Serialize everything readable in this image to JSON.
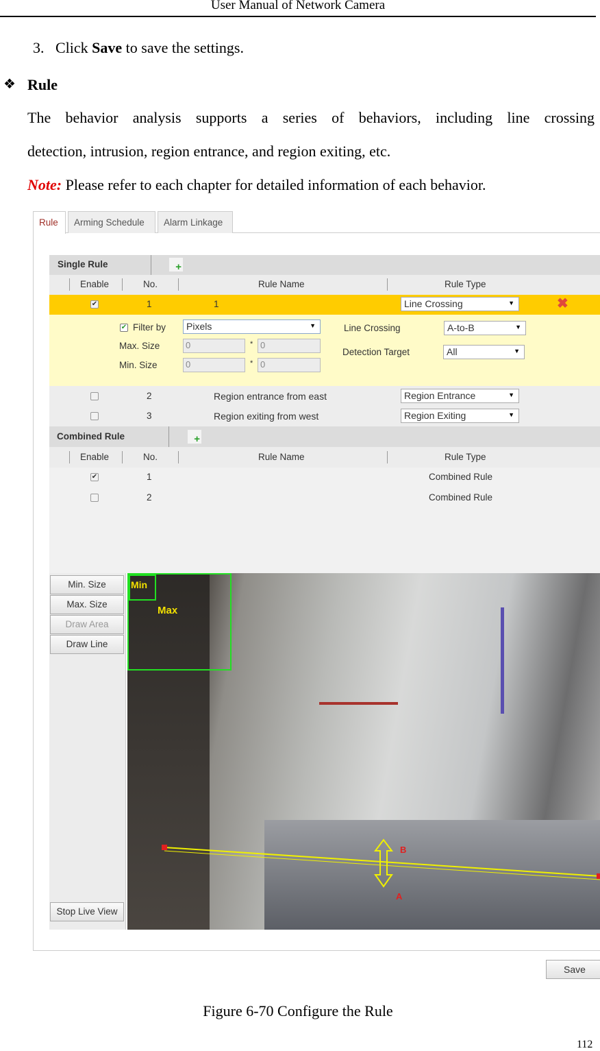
{
  "header": {
    "title": "User Manual of Network Camera"
  },
  "step": {
    "number": "3.",
    "prefix": "Click ",
    "bold": "Save",
    "suffix": " to save the settings."
  },
  "section": {
    "bullet_icon": "diamond-bullet-icon",
    "title": "Rule"
  },
  "paragraph": {
    "line1": "The behavior analysis supports a series of behaviors, including line crossing",
    "line2": "detection, intrusion, region entrance, and region exiting, etc."
  },
  "note": {
    "label": "Note:",
    "text": " Please refer to each chapter for detailed information of each behavior."
  },
  "ui": {
    "tabs": [
      {
        "label": "Rule"
      },
      {
        "label": "Arming Schedule"
      },
      {
        "label": "Alarm Linkage"
      }
    ],
    "single_rule": {
      "title": "Single Rule",
      "columns": {
        "enable": "Enable",
        "no": "No.",
        "name": "Rule Name",
        "type": "Rule Type"
      },
      "rows": [
        {
          "enabled": true,
          "no": "1",
          "name": "1",
          "type": "Line Crossing"
        },
        {
          "enabled": false,
          "no": "2",
          "name": "Region entrance from east",
          "type": "Region Entrance"
        },
        {
          "enabled": false,
          "no": "3",
          "name": "Region exiting from west",
          "type": "Region Exiting"
        }
      ],
      "details": {
        "filter_label": "Filter by",
        "filter_value": "Pixels",
        "max_label": "Max. Size",
        "min_label": "Min. Size",
        "max_w": "0",
        "max_h": "0",
        "min_w": "0",
        "min_h": "0",
        "times": "*",
        "line_crossing_label": "Line Crossing",
        "line_crossing_value": "A-to-B",
        "target_label": "Detection Target",
        "target_value": "All"
      }
    },
    "combined_rule": {
      "title": "Combined Rule",
      "columns": {
        "enable": "Enable",
        "no": "No.",
        "name": "Rule Name",
        "type": "Rule Type"
      },
      "rows": [
        {
          "enabled": true,
          "no": "1",
          "type": "Combined Rule"
        },
        {
          "enabled": false,
          "no": "2",
          "type": "Combined Rule"
        }
      ]
    },
    "buttons": {
      "min_size": "Min. Size",
      "max_size": "Max. Size",
      "draw_area": "Draw Area",
      "draw_line": "Draw Line",
      "stop_live_view": "Stop Live View",
      "save": "Save"
    },
    "overlay": {
      "min": "Min",
      "max": "Max",
      "a": "A",
      "b": "B"
    },
    "colors": {
      "selected_row": "#ffcc00",
      "detail_bg": "#fffbc8",
      "tab_active": "#a0312a"
    }
  },
  "caption": "Figure 6-70 Configure the Rule",
  "page_number": "112"
}
